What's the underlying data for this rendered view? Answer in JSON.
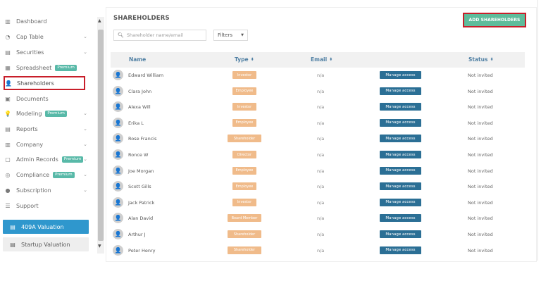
{
  "sidebar": {
    "items": [
      {
        "label": "Dashboard",
        "icon": "bar-chart-icon",
        "glyph": "▥",
        "chevron": false,
        "badge": ""
      },
      {
        "label": "Cap Table",
        "icon": "pie-chart-icon",
        "glyph": "◔",
        "chevron": true,
        "badge": ""
      },
      {
        "label": "Securities",
        "icon": "document-icon",
        "glyph": "▤",
        "chevron": true,
        "badge": ""
      },
      {
        "label": "Spreadsheet",
        "icon": "spreadsheet-icon",
        "glyph": "▦",
        "chevron": false,
        "badge": "Premium"
      },
      {
        "label": "Shareholders",
        "icon": "user-icon",
        "glyph": "👤",
        "chevron": false,
        "badge": "",
        "active": true
      },
      {
        "label": "Documents",
        "icon": "folder-icon",
        "glyph": "▣",
        "chevron": false,
        "badge": ""
      },
      {
        "label": "Modeling",
        "icon": "bulb-icon",
        "glyph": "💡",
        "chevron": true,
        "badge": "Premium"
      },
      {
        "label": "Reports",
        "icon": "report-icon",
        "glyph": "▤",
        "chevron": true,
        "badge": ""
      },
      {
        "label": "Company",
        "icon": "building-icon",
        "glyph": "▥",
        "chevron": true,
        "badge": ""
      },
      {
        "label": "Admin Records",
        "icon": "records-icon",
        "glyph": "▢",
        "chevron": true,
        "badge": "Premium"
      },
      {
        "label": "Compliance",
        "icon": "compliance-icon",
        "glyph": "◎",
        "chevron": true,
        "badge": "Premium"
      },
      {
        "label": "Subscription",
        "icon": "info-icon",
        "glyph": "●",
        "chevron": true,
        "badge": ""
      },
      {
        "label": "Support",
        "icon": "support-icon",
        "glyph": "☰",
        "chevron": false,
        "badge": ""
      }
    ],
    "valuation_409a": "409A Valuation",
    "startup_valuation": "Startup Valuation"
  },
  "header": {
    "title": "SHAREHOLDERS",
    "add_button": "ADD SHAREHOLDERS"
  },
  "toolbar": {
    "search_placeholder": "Shareholder name/email",
    "filters_label": "Filters"
  },
  "table": {
    "columns": {
      "name": "Name",
      "type": "Type",
      "email": "Email",
      "status": "Status"
    },
    "manage_label": "Manage access",
    "rows": [
      {
        "name": "Edward William",
        "type": "Investor",
        "email": "n/a",
        "status": "Not invited"
      },
      {
        "name": "Clara John",
        "type": "Employee",
        "email": "n/a",
        "status": "Not invited"
      },
      {
        "name": "Alexa Will",
        "type": "Investor",
        "email": "n/a",
        "status": "Not invited"
      },
      {
        "name": "Erika L",
        "type": "Employee",
        "email": "n/a",
        "status": "Not invited"
      },
      {
        "name": "Rose Francis",
        "type": "Shareholder",
        "email": "n/a",
        "status": "Not invited"
      },
      {
        "name": "Ronce W",
        "type": "Director",
        "email": "n/a",
        "status": "Not invited"
      },
      {
        "name": "Joe Morgan",
        "type": "Employee",
        "email": "n/a",
        "status": "Not invited"
      },
      {
        "name": "Scott Gills",
        "type": "Employee",
        "email": "n/a",
        "status": "Not invited"
      },
      {
        "name": "Jack Patrick",
        "type": "Investor",
        "email": "n/a",
        "status": "Not invited"
      },
      {
        "name": "Alan David",
        "type": "Board Member",
        "email": "n/a",
        "status": "Not invited"
      },
      {
        "name": "Arthur J",
        "type": "Shareholder",
        "email": "n/a",
        "status": "Not invited"
      },
      {
        "name": "Peter Henry",
        "type": "Shareholder",
        "email": "n/a",
        "status": "Not invited"
      }
    ]
  },
  "colors": {
    "accent_green": "#5ebc9b",
    "pill_orange": "#f0bb8a",
    "manage_blue": "#2b6f95",
    "highlight_red": "#c81e2a",
    "valuation_blue": "#2f97cd"
  }
}
